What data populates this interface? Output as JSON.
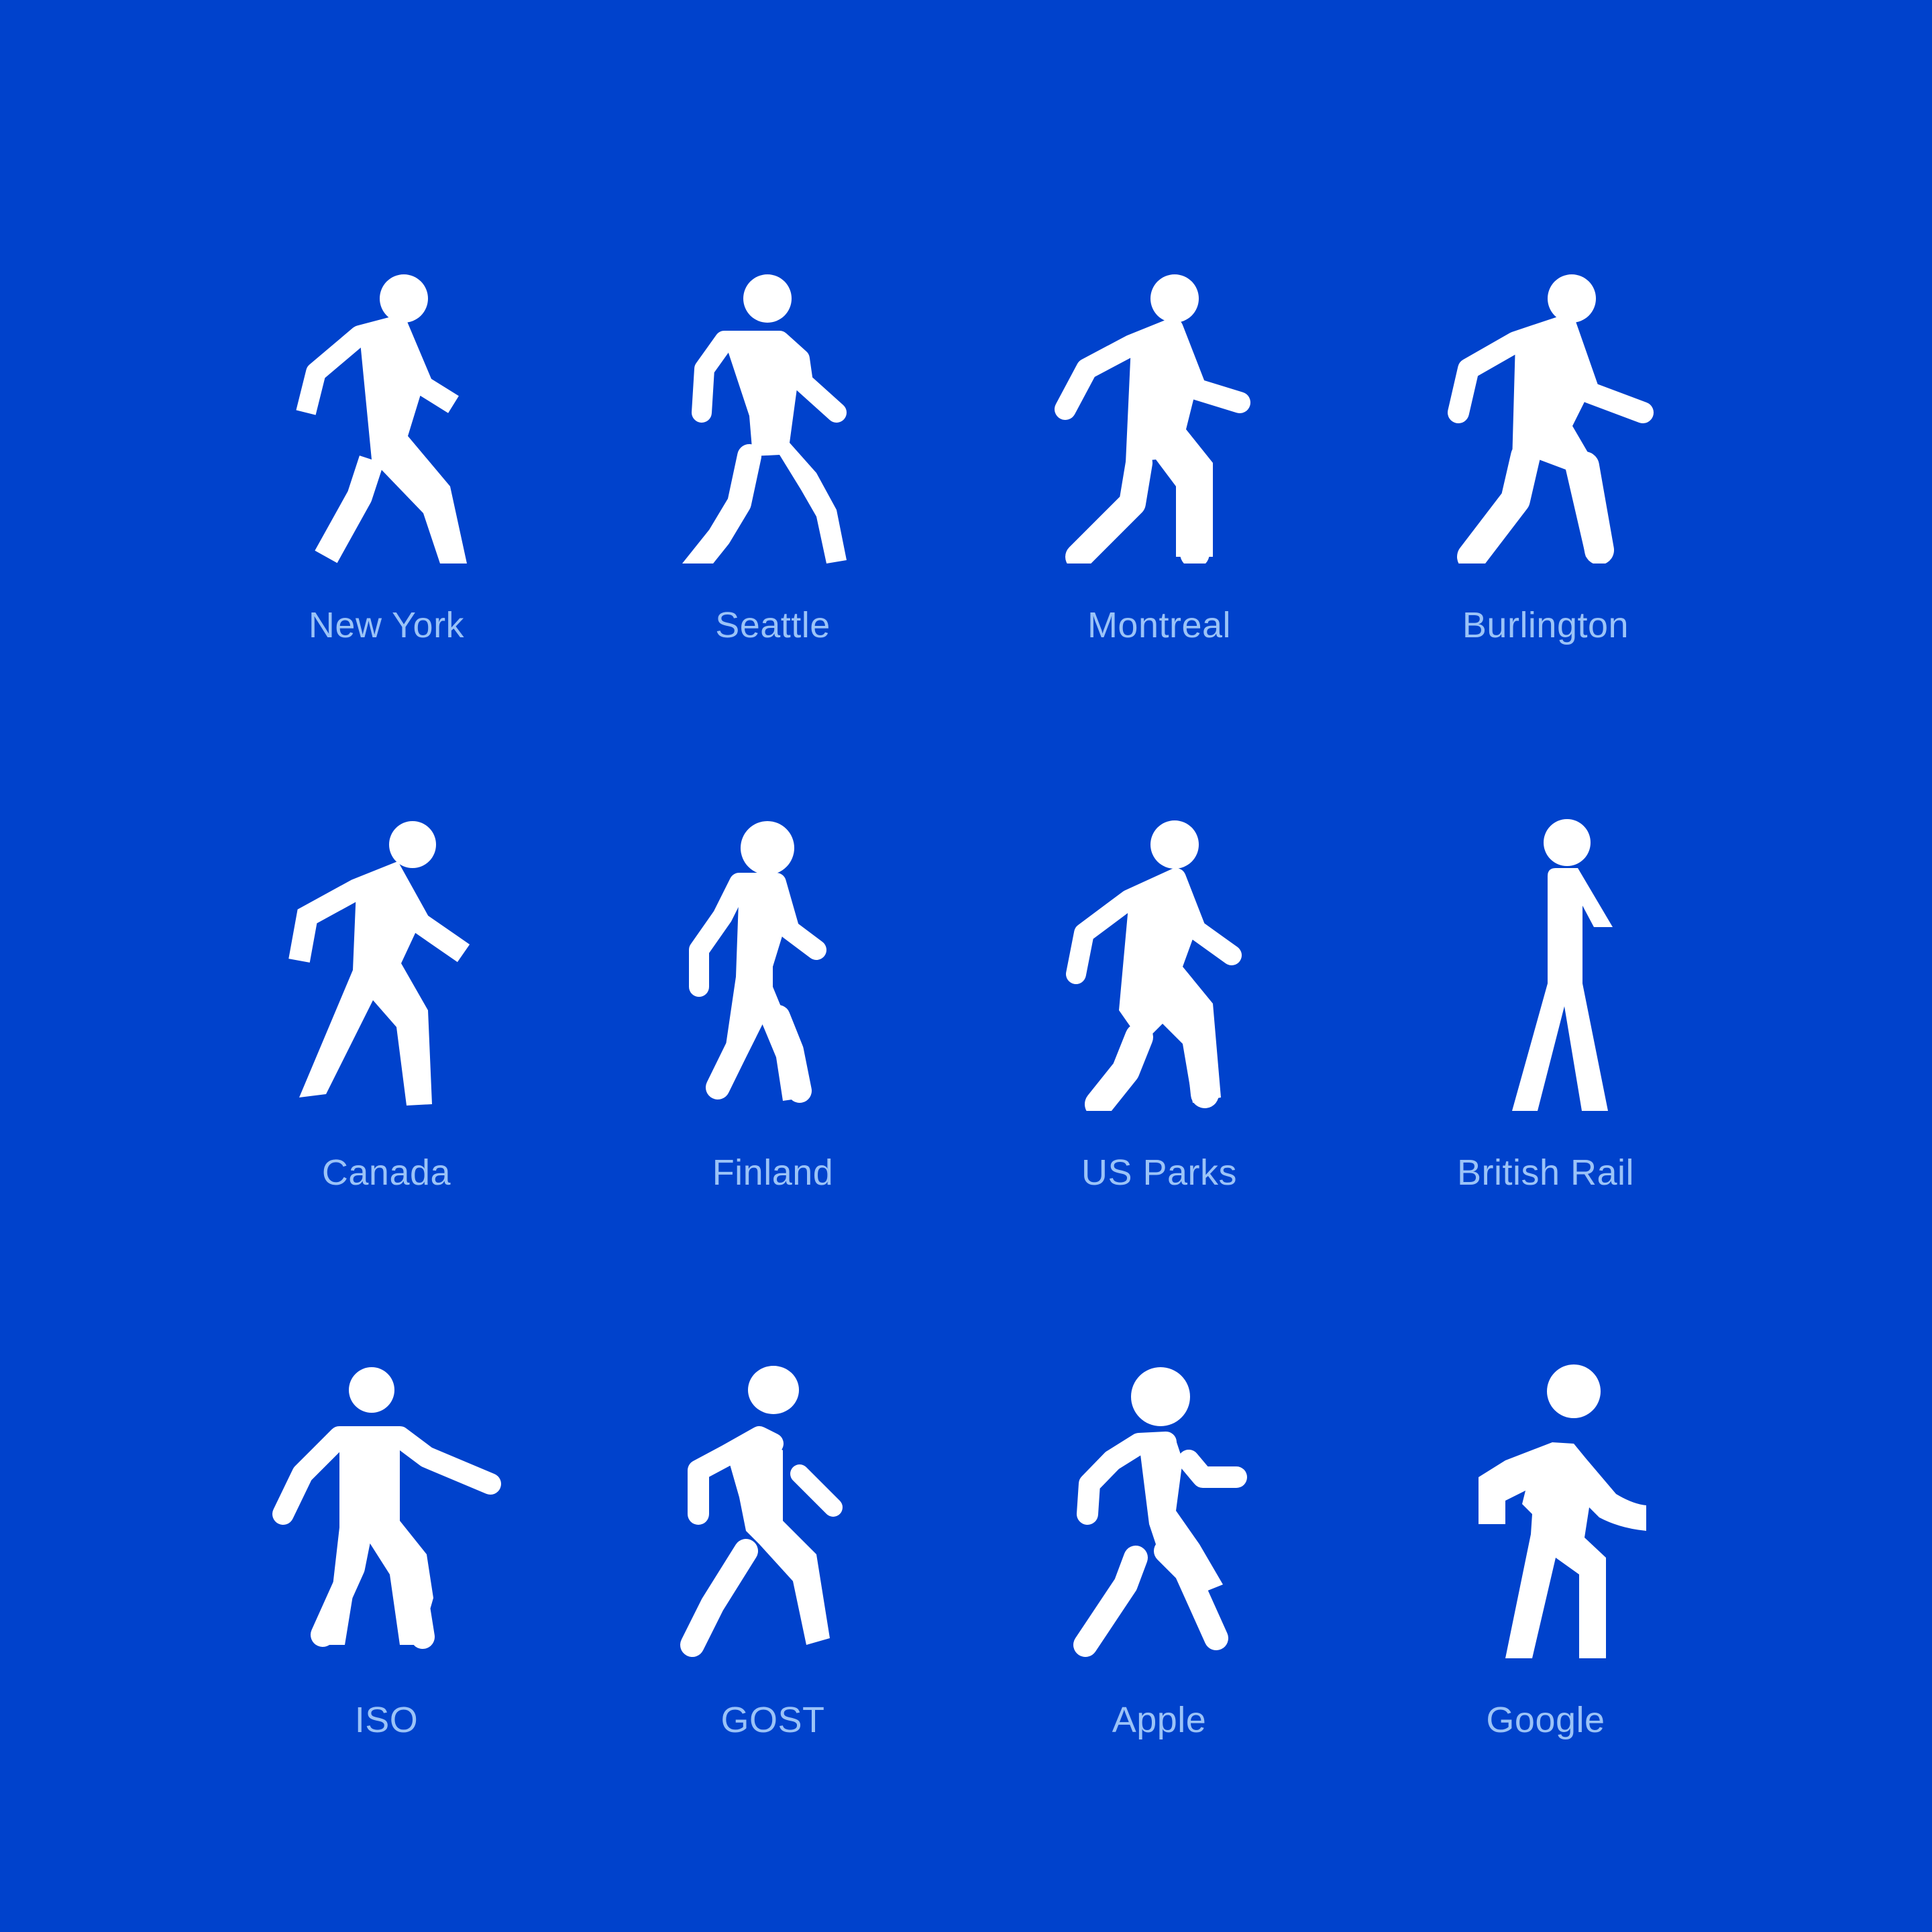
{
  "page": {
    "background_color": "#0042CC",
    "icon_color": "#FFFFFF",
    "label_color": "#9BC3F7"
  },
  "icons": [
    {
      "label": "New York",
      "icon": "pedestrian-walking-icon"
    },
    {
      "label": "Seattle",
      "icon": "pedestrian-walking-icon"
    },
    {
      "label": "Montreal",
      "icon": "pedestrian-walking-icon"
    },
    {
      "label": "Burlington",
      "icon": "pedestrian-walking-icon"
    },
    {
      "label": "Canada",
      "icon": "pedestrian-walking-icon"
    },
    {
      "label": "Finland",
      "icon": "pedestrian-walking-icon"
    },
    {
      "label": "US Parks",
      "icon": "pedestrian-walking-icon"
    },
    {
      "label": "British Rail",
      "icon": "pedestrian-walking-icon"
    },
    {
      "label": "ISO",
      "icon": "pedestrian-walking-icon"
    },
    {
      "label": "GOST",
      "icon": "pedestrian-walking-icon"
    },
    {
      "label": "Apple",
      "icon": "pedestrian-walking-icon"
    },
    {
      "label": "Google",
      "icon": "pedestrian-walking-icon"
    }
  ]
}
